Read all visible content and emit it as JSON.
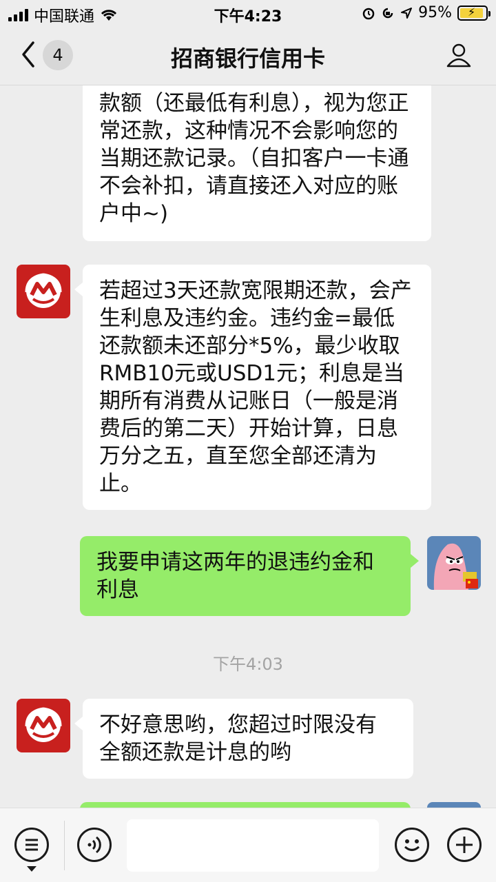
{
  "status_bar": {
    "carrier": "中国联通",
    "time": "下午4:23",
    "battery": "95%"
  },
  "nav": {
    "unread_count": "4",
    "title": "招商银行信用卡"
  },
  "messages": {
    "m1_cont": "款额（还最低有利息），视为您正常还款，这种情况不会影响您的当期还款记录。（自扣客户一卡通不会补扣，请直接还入对应的账户中~)",
    "m2": "若超过3天还款宽限期还款，会产生利息及违约金。违约金=最低还款额未还部分*5%，最少收取RMB10元或USD1元；利息是当期所有消费从记账日（一般是消费后的第二天）开始计算，日息万分之五，直至您全部还清为止。",
    "m3": "我要申请这两年的退违约金和利息",
    "timestamp": "下午4:03",
    "m4": "不好意思哟，您超过时限没有全额还款是计息的哟"
  },
  "colors": {
    "bubble_out": "#95ec69",
    "bubble_in": "#ffffff",
    "bank_red": "#c8201e"
  },
  "icons": [
    "back-chevron-icon",
    "profile-icon",
    "menu-list-icon",
    "voice-icon",
    "emoji-icon",
    "add-icon",
    "wifi-icon",
    "alarm-icon",
    "location-arrow-icon"
  ]
}
